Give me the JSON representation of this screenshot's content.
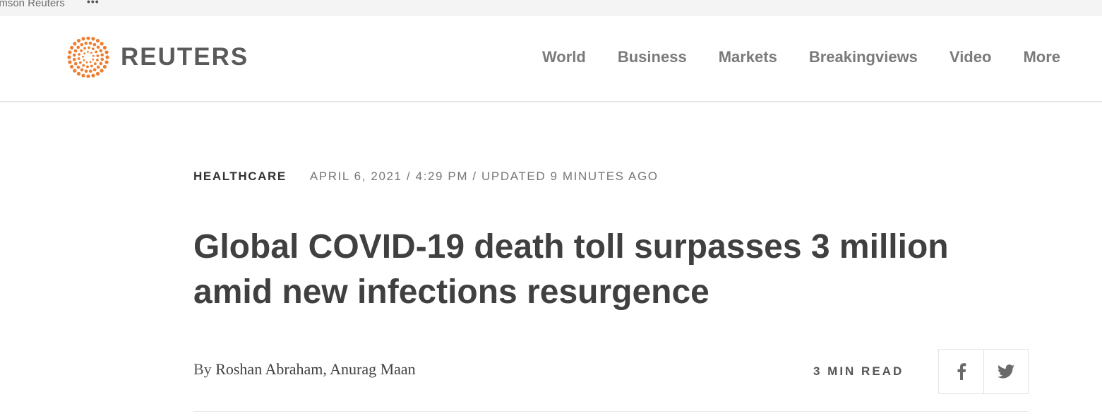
{
  "top_strip": {
    "brand_text": "omson Reuters",
    "more_glyph": "•••"
  },
  "header": {
    "logo": {
      "icon": "reuters-dot-logo-icon",
      "wordmark": "REUTERS",
      "color": "#ef7d2e"
    },
    "nav": [
      "World",
      "Business",
      "Markets",
      "Breakingviews",
      "Video",
      "More"
    ]
  },
  "article": {
    "section": "HEALTHCARE",
    "dateline": "APRIL 6, 2021 / 4:29 PM / UPDATED 9 MINUTES AGO",
    "headline": "Global COVID-19 death toll surpasses 3 million amid new infections resurgence",
    "byline": {
      "prefix": "By",
      "authors": "Roshan Abraham, Anurag Maan"
    },
    "read_time": "3 MIN READ",
    "share": {
      "facebook_icon": "facebook-icon",
      "twitter_icon": "twitter-icon"
    }
  }
}
